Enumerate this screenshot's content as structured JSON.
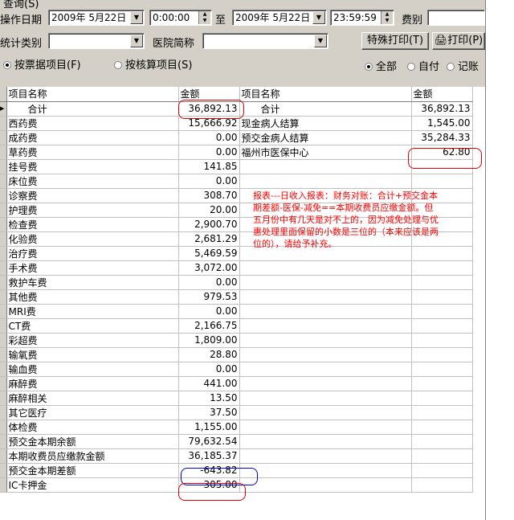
{
  "menu": {
    "query": "查询(S)"
  },
  "filters": {
    "op_date_label": "操作日期",
    "date_from": "2009年  5月22日",
    "time_from": "0:00:00",
    "to_label": "至",
    "date_to": "2009年  5月22日",
    "time_to": "23:59:59",
    "fee_label": "费别",
    "fee_value": "",
    "stat_label": "统计类别",
    "stat_value": "",
    "hospital_label": "医院简称",
    "hospital_value": ""
  },
  "buttons": {
    "special_print": "特殊打印(T)",
    "print": "打印(P)"
  },
  "radios": {
    "by_invoice": "按票据项目(F)",
    "by_accounting": "按核算项目(S)",
    "all": "全部",
    "self_pay": "自付",
    "on_account": "记账"
  },
  "grid": {
    "headers": [
      "项目名称",
      "金额",
      "项目名称",
      "金额"
    ],
    "left_rows": [
      [
        "　　合计",
        "36,892.13"
      ],
      [
        "西药费",
        "15,666.92"
      ],
      [
        "成药费",
        "0.00"
      ],
      [
        "草药费",
        "0.00"
      ],
      [
        "挂号费",
        "141.85"
      ],
      [
        "床位费",
        "0.00"
      ],
      [
        "诊察费",
        "308.70"
      ],
      [
        "护理费",
        "20.00"
      ],
      [
        "检查费",
        "2,900.70"
      ],
      [
        "化验费",
        "2,681.29"
      ],
      [
        "治疗费",
        "5,469.59"
      ],
      [
        "手术费",
        "3,072.00"
      ],
      [
        "救护车费",
        "0.00"
      ],
      [
        "其他费",
        "979.53"
      ],
      [
        "MRI费",
        "0.00"
      ],
      [
        "CT费",
        "2,166.75"
      ],
      [
        "彩超费",
        "1,809.00"
      ],
      [
        "输氧费",
        "28.80"
      ],
      [
        "输血费",
        "0.00"
      ],
      [
        "麻醉费",
        "441.00"
      ],
      [
        "麻醉相关",
        "13.50"
      ],
      [
        "其它医疗",
        "37.50"
      ],
      [
        "体检费",
        "1,155.00"
      ],
      [
        "预交金本期余额",
        "79,632.54"
      ],
      [
        "本期收费员应缴款金额",
        "36,185.37"
      ],
      [
        "预交金本期差额",
        "-643.82"
      ],
      [
        "IC卡押金",
        "305.00"
      ]
    ],
    "right_rows": [
      [
        "　　合计",
        "36,892.13"
      ],
      [
        "现金病人结算",
        "1,545.00"
      ],
      [
        "预交金病人结算",
        "35,284.33"
      ],
      [
        "福州市医保中心",
        "62.80"
      ]
    ]
  },
  "annotation": "报表---日收入报表：财务对账：合计+预交金本期差额-医保-减免==本期收费员应缴金额。但五月份中有几天是对不上的，因为减免处理与优惠处理里面保留的小数是三位的（本来应该是两位的），请给予补充。"
}
